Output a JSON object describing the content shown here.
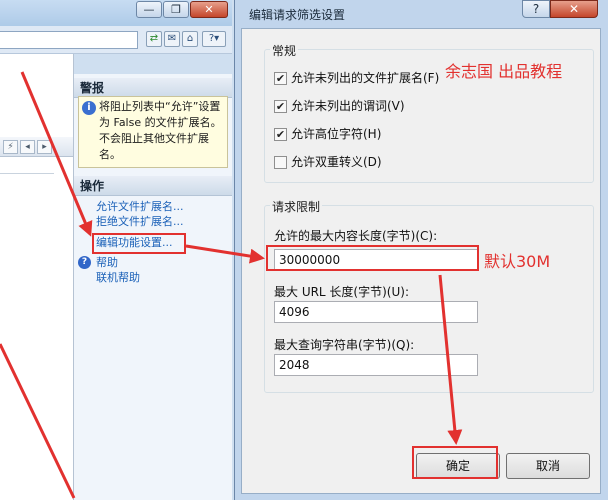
{
  "background_window": {
    "window_buttons": {
      "minimize": "—",
      "restore": "❐",
      "close": "✕"
    },
    "help_button": "?",
    "actions_pane": {
      "alerts_header": "警报",
      "alert_text": "将阻止列表中“允许”设置为 False 的文件扩展名。不会阻止其他文件扩展名。",
      "actions_header": "操作",
      "links": [
        "允许文件扩展名...",
        "拒绝文件扩展名...",
        "编辑功能设置...",
        "帮助",
        "联机帮助"
      ]
    }
  },
  "dialog": {
    "title": "编辑请求筛选设置",
    "help_button": "?",
    "close_button": "✕",
    "general": {
      "legend": "常规",
      "options": [
        {
          "label": "允许未列出的文件扩展名(F)",
          "checked": true
        },
        {
          "label": "允许未列出的谓词(V)",
          "checked": true
        },
        {
          "label": "允许高位字符(H)",
          "checked": true
        },
        {
          "label": "允许双重转义(D)",
          "checked": false
        }
      ]
    },
    "limits": {
      "legend": "请求限制",
      "max_content_label": "允许的最大内容长度(字节)(C):",
      "max_content_value": "30000000",
      "max_url_label": "最大 URL 长度(字节)(U):",
      "max_url_value": "4096",
      "max_query_label": "最大查询字符串(字节)(Q):",
      "max_query_value": "2048"
    },
    "ok_button": "确定",
    "cancel_button": "取消"
  },
  "annotations": {
    "watermark": "余志国 出品教程",
    "default_note": "默认30M",
    "color": "#e2312f"
  }
}
